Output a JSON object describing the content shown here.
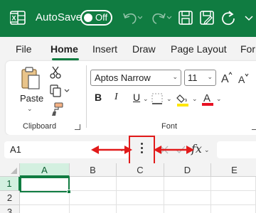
{
  "titlebar": {
    "autosave_label": "AutoSave",
    "toggle_state": "Off",
    "icons": [
      "excel-logo-icon",
      "undo-icon",
      "redo-icon",
      "save-icon",
      "save-as-icon",
      "refresh-icon"
    ]
  },
  "tabs": [
    {
      "label": "File",
      "active": false
    },
    {
      "label": "Home",
      "active": true
    },
    {
      "label": "Insert",
      "active": false
    },
    {
      "label": "Draw",
      "active": false
    },
    {
      "label": "Page Layout",
      "active": false
    },
    {
      "label": "For",
      "active": false
    }
  ],
  "ribbon": {
    "clipboard": {
      "paste_label": "Paste",
      "group_label": "Clipboard"
    },
    "font": {
      "family": "Aptos Narrow",
      "size": "11",
      "bold_label": "B",
      "italic_label": "I",
      "underline_label": "U",
      "group_label": "Font",
      "fill_color": "#ffe600",
      "font_color": "#e81123"
    }
  },
  "formula_bar": {
    "name_box": "A1",
    "fx_label": "fx",
    "formula_value": ""
  },
  "grid": {
    "columns": [
      "A",
      "B",
      "C",
      "D",
      "E"
    ],
    "rows": [
      "1",
      "2",
      "3"
    ],
    "selected_cell": "A1"
  },
  "colors": {
    "accent": "#107c41",
    "annotation": "#e11a1a"
  }
}
